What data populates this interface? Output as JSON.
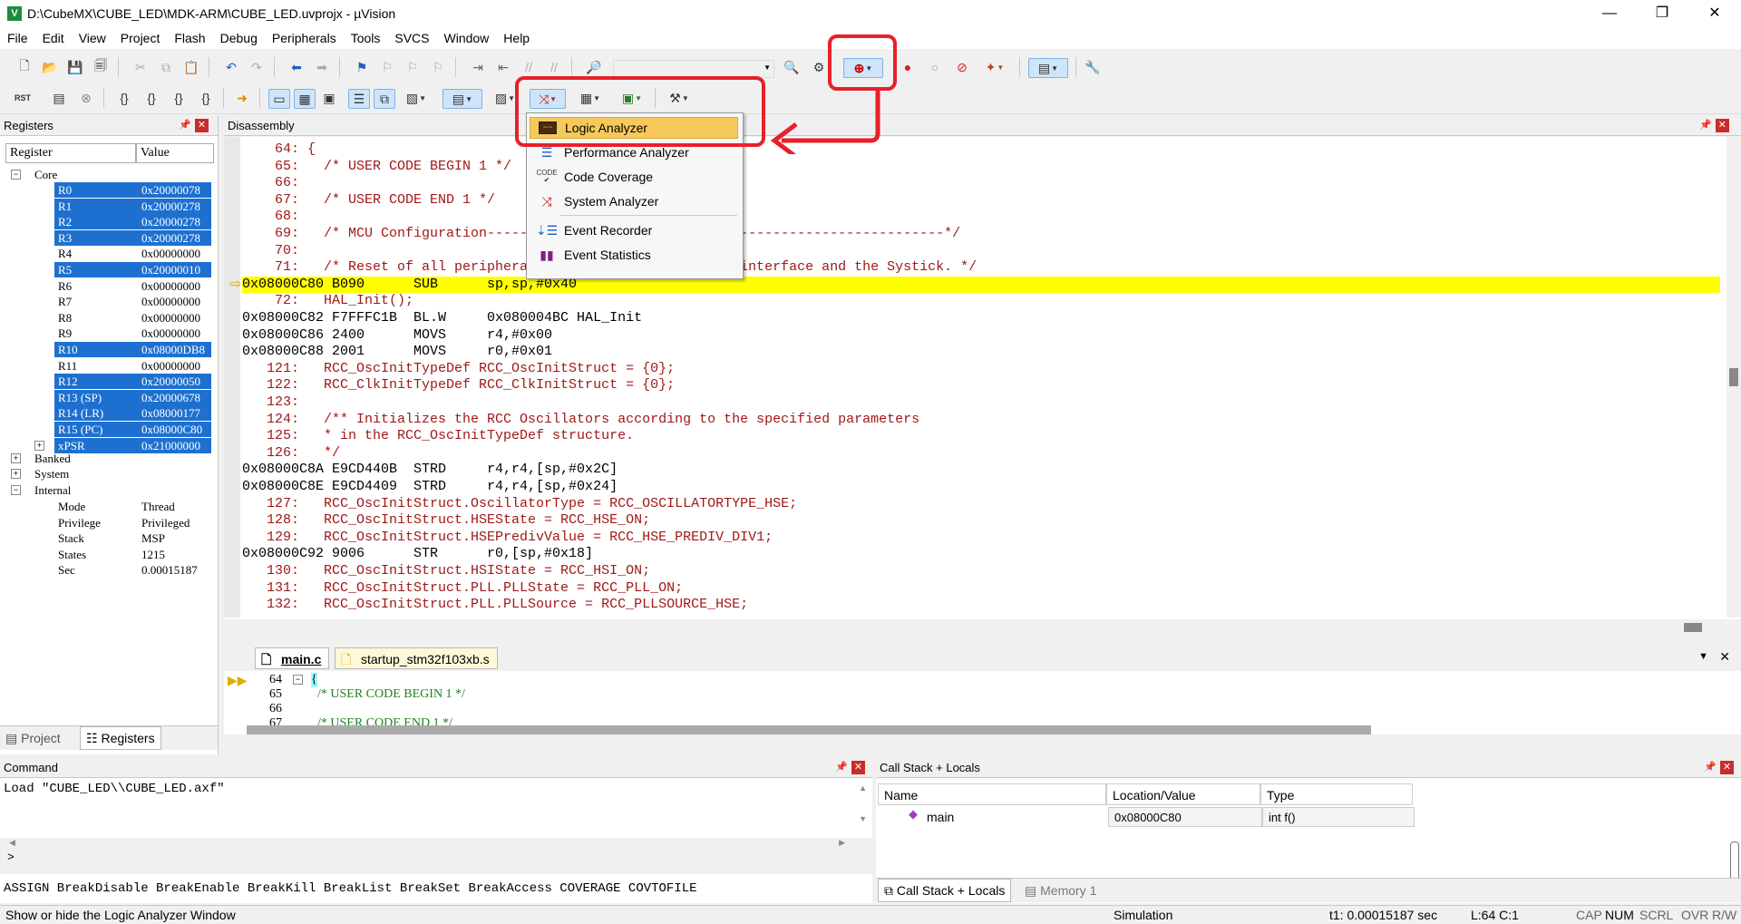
{
  "window": {
    "title": "D:\\CubeMX\\CUBE_LED\\MDK-ARM\\CUBE_LED.uvprojx - µVision",
    "minimize": "—",
    "maximize": "❐",
    "close": "✕"
  },
  "menu": [
    "File",
    "Edit",
    "View",
    "Project",
    "Flash",
    "Debug",
    "Peripherals",
    "Tools",
    "SVCS",
    "Window",
    "Help"
  ],
  "registers": {
    "title": "Registers",
    "col_register": "Register",
    "col_value": "Value",
    "core_label": "Core",
    "rows": [
      {
        "name": "R0",
        "value": "0x20000078",
        "selected": true
      },
      {
        "name": "R1",
        "value": "0x20000278",
        "selected": true
      },
      {
        "name": "R2",
        "value": "0x20000278",
        "selected": true
      },
      {
        "name": "R3",
        "value": "0x20000278",
        "selected": true
      },
      {
        "name": "R4",
        "value": "0x00000000",
        "selected": false
      },
      {
        "name": "R5",
        "value": "0x20000010",
        "selected": true
      },
      {
        "name": "R6",
        "value": "0x00000000",
        "selected": false
      },
      {
        "name": "R7",
        "value": "0x00000000",
        "selected": false
      },
      {
        "name": "R8",
        "value": "0x00000000",
        "selected": false
      },
      {
        "name": "R9",
        "value": "0x00000000",
        "selected": false
      },
      {
        "name": "R10",
        "value": "0x08000DB8",
        "selected": true
      },
      {
        "name": "R11",
        "value": "0x00000000",
        "selected": false
      },
      {
        "name": "R12",
        "value": "0x20000050",
        "selected": true
      },
      {
        "name": "R13 (SP)",
        "value": "0x20000678",
        "selected": true
      },
      {
        "name": "R14 (LR)",
        "value": "0x08000177",
        "selected": true
      },
      {
        "name": "R15 (PC)",
        "value": "0x08000C80",
        "selected": true
      },
      {
        "name": "xPSR",
        "value": "0x21000000",
        "selected": true
      }
    ],
    "groups": [
      "Banked",
      "System",
      "Internal"
    ],
    "internal": [
      {
        "name": "Mode",
        "value": "Thread"
      },
      {
        "name": "Privilege",
        "value": "Privileged"
      },
      {
        "name": "Stack",
        "value": "MSP"
      },
      {
        "name": "States",
        "value": "1215"
      },
      {
        "name": "Sec",
        "value": "0.00015187"
      }
    ],
    "tab_project": "Project",
    "tab_registers": "Registers"
  },
  "disassembly": {
    "title": "Disassembly",
    "lines": [
      {
        "text": "    64: {",
        "kind": "src"
      },
      {
        "text": "    65:   /* USER CODE BEGIN 1 */",
        "kind": "src"
      },
      {
        "text": "    66: ",
        "kind": "src"
      },
      {
        "text": "    67:   /* USER CODE END 1 */",
        "kind": "src"
      },
      {
        "text": "    68: ",
        "kind": "src"
      },
      {
        "text": "    69:   /* MCU Configuration--------------------------------------------------------*/",
        "kind": "src"
      },
      {
        "text": "    70: ",
        "kind": "src"
      },
      {
        "text": "    71:   /* Reset of all peripherals, Initializes the Flash interface and the Systick. */",
        "kind": "src"
      },
      {
        "text": "0x08000C80 B090      SUB      sp,sp,#0x40",
        "kind": "cur"
      },
      {
        "text": "    72:   HAL_Init();",
        "kind": "src"
      },
      {
        "text": "0x08000C82 F7FFFC1B  BL.W     0x080004BC HAL_Init",
        "kind": "asm"
      },
      {
        "text": "0x08000C86 2400      MOVS     r4,#0x00",
        "kind": "asm"
      },
      {
        "text": "0x08000C88 2001      MOVS     r0,#0x01",
        "kind": "asm"
      },
      {
        "text": "   121:   RCC_OscInitTypeDef RCC_OscInitStruct = {0};",
        "kind": "src"
      },
      {
        "text": "   122:   RCC_ClkInitTypeDef RCC_ClkInitStruct = {0};",
        "kind": "src"
      },
      {
        "text": "   123: ",
        "kind": "src"
      },
      {
        "text": "   124:   /** Initializes the RCC Oscillators according to the specified parameters",
        "kind": "src"
      },
      {
        "text": "   125:   * in the RCC_OscInitTypeDef structure.",
        "kind": "src"
      },
      {
        "text": "   126:   */",
        "kind": "src"
      },
      {
        "text": "0x08000C8A E9CD440B  STRD     r4,r4,[sp,#0x2C]",
        "kind": "asm"
      },
      {
        "text": "0x08000C8E E9CD4409  STRD     r4,r4,[sp,#0x24]",
        "kind": "asm"
      },
      {
        "text": "   127:   RCC_OscInitStruct.OscillatorType = RCC_OSCILLATORTYPE_HSE;",
        "kind": "src"
      },
      {
        "text": "   128:   RCC_OscInitStruct.HSEState = RCC_HSE_ON;",
        "kind": "src"
      },
      {
        "text": "   129:   RCC_OscInitStruct.HSEPredivValue = RCC_HSE_PREDIV_DIV1;",
        "kind": "src"
      },
      {
        "text": "0x08000C92 9006      STR      r0,[sp,#0x18]",
        "kind": "asm"
      },
      {
        "text": "   130:   RCC_OscInitStruct.HSIState = RCC_HSI_ON;",
        "kind": "src"
      },
      {
        "text": "   131:   RCC_OscInitStruct.PLL.PLLState = RCC_PLL_ON;",
        "kind": "src"
      },
      {
        "text": "   132:   RCC_OscInitStruct.PLL.PLLSource = RCC_PLLSOURCE_HSE;",
        "kind": "src"
      }
    ]
  },
  "analysis_menu": {
    "items": [
      {
        "label": "Logic Analyzer",
        "icon": "logic-analyzer-icon",
        "highlighted": true
      },
      {
        "label": "Performance Analyzer",
        "icon": "performance-analyzer-icon",
        "highlighted": false
      },
      {
        "label": "Code Coverage",
        "icon": "code-coverage-icon",
        "highlighted": false
      },
      {
        "label": "System Analyzer",
        "icon": "system-analyzer-icon",
        "highlighted": false
      },
      {
        "label": "Event Recorder",
        "icon": "event-recorder-icon",
        "highlighted": false
      },
      {
        "label": "Event Statistics",
        "icon": "event-statistics-icon",
        "highlighted": false
      }
    ]
  },
  "editor": {
    "tabs": [
      "main.c",
      "startup_stm32f103xb.s"
    ],
    "lines": [
      {
        "num": "64",
        "text": "{"
      },
      {
        "num": "65",
        "text": "  /* USER CODE BEGIN 1 */"
      },
      {
        "num": "66",
        "text": ""
      },
      {
        "num": "67",
        "text": "  /* USER CODE END 1 */"
      }
    ]
  },
  "command": {
    "title": "Command",
    "output": "Load \"CUBE_LED\\\\CUBE_LED.axf\"",
    "prompt": ">",
    "hints": "ASSIGN BreakDisable BreakEnable BreakKill BreakList BreakSet BreakAccess COVERAGE COVTOFILE"
  },
  "callstack": {
    "title": "Call Stack + Locals",
    "col_name": "Name",
    "col_location": "Location/Value",
    "col_type": "Type",
    "rows": [
      {
        "name": "main",
        "location": "0x08000C80",
        "type": "int f()"
      }
    ],
    "tab_callstack": "Call Stack + Locals",
    "tab_memory": "Memory 1"
  },
  "status": {
    "message": "Show or hide the Logic Analyzer Window",
    "mode": "Simulation",
    "time": "t1: 0.00015187 sec",
    "position": "L:64 C:1",
    "caps": "CAP",
    "num": "NUM",
    "scrl": "SCRL",
    "ovr": "OVR",
    "rw": "R/W"
  },
  "colors": {
    "accent_red": "#e8202a",
    "selection_blue": "#1e70d0",
    "current_line": "#ffff00",
    "menu_highlight": "#f7c95c"
  }
}
